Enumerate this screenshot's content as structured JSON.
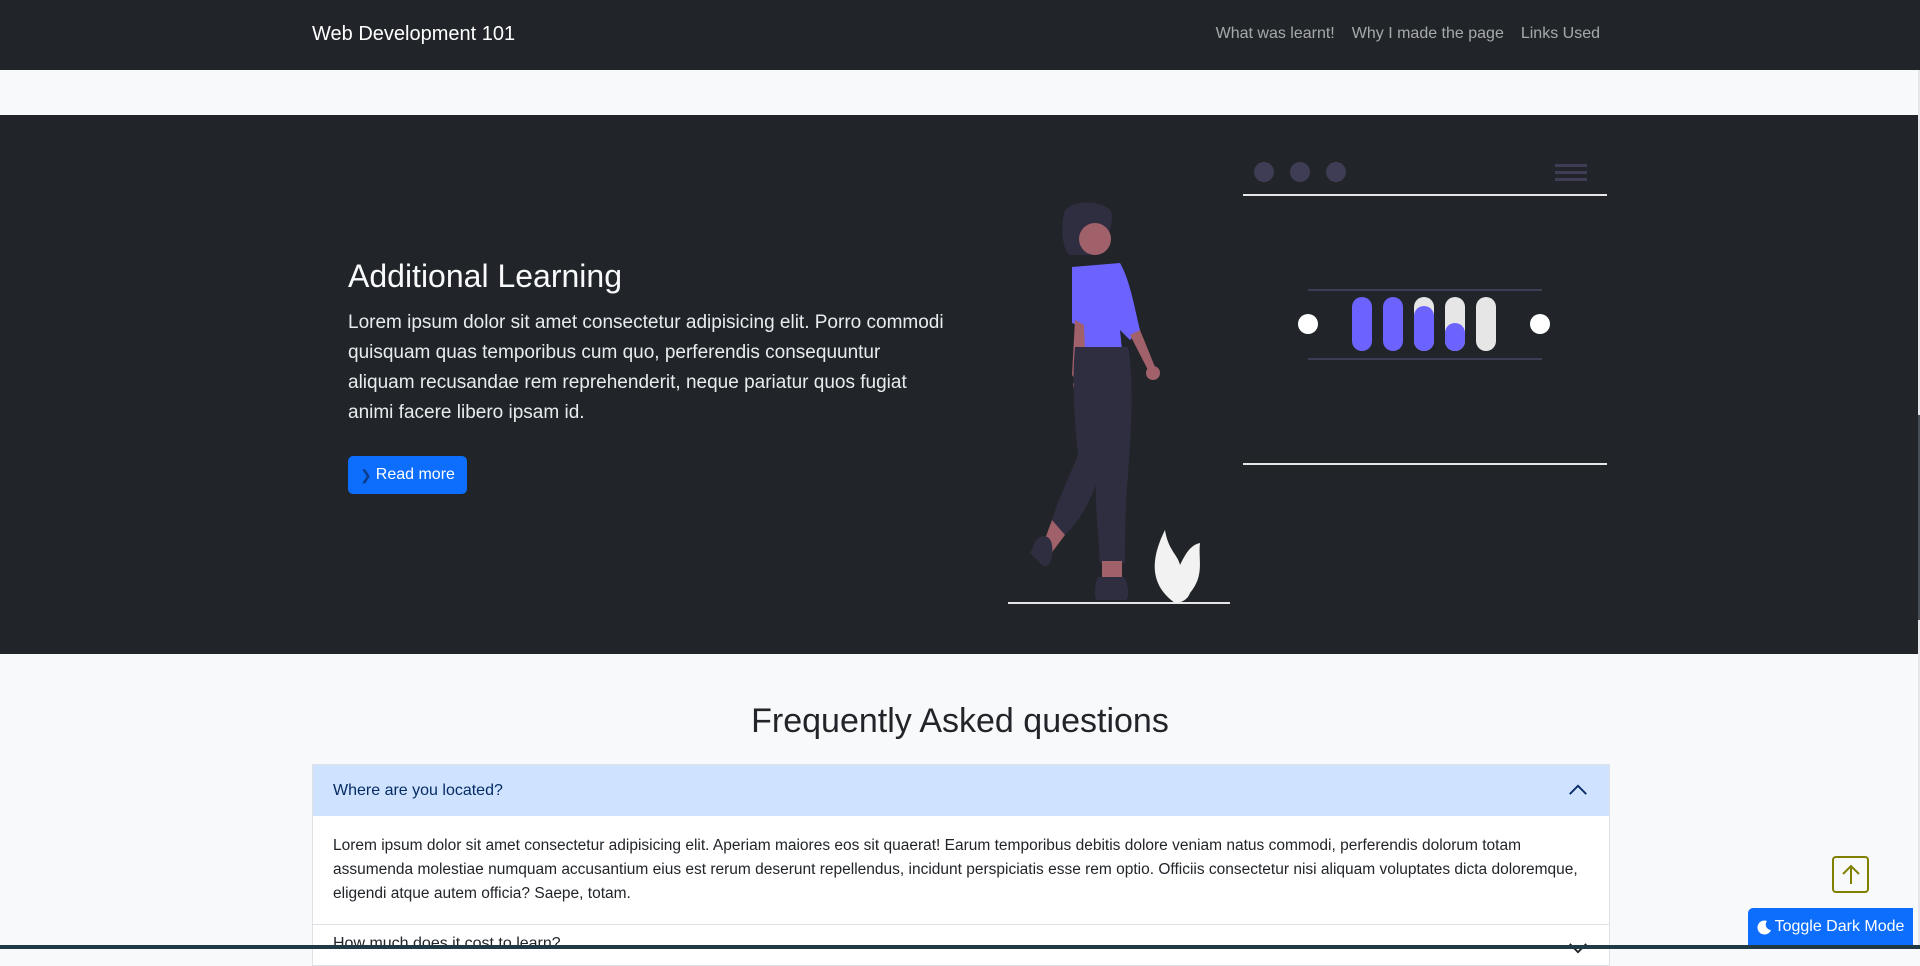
{
  "navbar": {
    "brand": "Web Development 101",
    "links": [
      "What was learnt!",
      "Why I made the page",
      "Links Used"
    ]
  },
  "hero": {
    "title": "Additional Learning",
    "text": "Lorem ipsum dolor sit amet consectetur adipisicing elit. Porro commodi quisquam quas temporibus cum quo, perferendis consequuntur aliquam recusandae rem reprehenderit, neque pariatur quos fugiat animi facere libero ipsam id.",
    "button_label": "Read more",
    "button_icon": "chevron-right-icon"
  },
  "faq": {
    "title": "Frequently Asked questions",
    "items": [
      {
        "question": "Where are you located?",
        "answer": "Lorem ipsum dolor sit amet consectetur adipisicing elit. Aperiam maiores eos sit quaerat! Earum temporibus debitis dolore veniam natus commodi, perferendis dolorum totam assumenda molestiae numquam accusantium eius est rerum deserunt repellendus, incidunt perspiciatis esse rem optio. Officiis consectetur nisi aliquam voluptates dicta doloremque, eligendi atque autem officia? Saepe, totam.",
        "expanded": true
      },
      {
        "question": "How much does it cost to learn?",
        "expanded": false
      }
    ]
  },
  "floating": {
    "scroll_top_icon": "arrow-up-square-icon",
    "dark_toggle_label": "Toggle Dark Mode",
    "dark_toggle_icon": "moon-icon"
  },
  "colors": {
    "navbar_bg": "#212529",
    "hero_bg": "#212529",
    "primary": "#0d6efd",
    "illustration_accent": "#6c63ff",
    "accordion_active_bg": "#cfe2ff",
    "scroll_top_border": "#808000"
  }
}
